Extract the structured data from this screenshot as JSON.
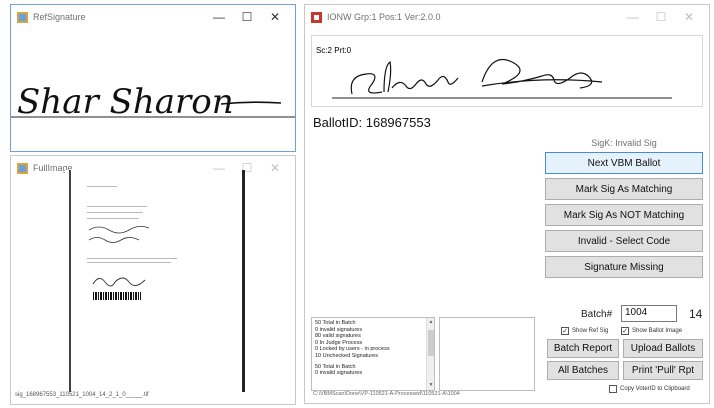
{
  "ref_window": {
    "title": "RefSignature",
    "signature_text": "Shar Sharon",
    "controls": [
      "—",
      "☐",
      "✕"
    ]
  },
  "full_window": {
    "title": "FullImage",
    "caption": "sig_168967553_110521_1004_14_2_1_0_____.tif",
    "controls": [
      "—",
      "☐",
      "✕"
    ]
  },
  "main_window": {
    "title": "IONW Grp:1 Pos:1 Ver:2.0.0",
    "controls": [
      "—",
      "☐",
      "✕"
    ],
    "sc_prt": "Sc:2 Prt:0",
    "ballot_id": "BallotID: 168967553",
    "sigk_status": "SigK: Invalid Sig",
    "buttons": {
      "next": "Next VBM Ballot",
      "match": "Mark Sig As Matching",
      "not_match": "Mark Sig As NOT Matching",
      "invalid": "Invalid - Select Code",
      "missing": "Signature Missing",
      "batch_report": "Batch Report",
      "upload": "Upload Ballots",
      "all_batches": "All Batches",
      "print_pull": "Print 'Pull' Rpt"
    },
    "stats": [
      "50 Total in Batch",
      "0 invalid signatures",
      "80 valid signatures",
      "0 In Judge Process",
      "0 Locked by users - in process",
      "10 Unchecked Signatures",
      "",
      "50 Total in Batch",
      "0 invalid signatures"
    ],
    "batch_label": "Batch#",
    "batch_value": "1004",
    "batch_count": "14",
    "show_ref_sig": "Show Ref Sig",
    "show_ballot_image": "Show Ballot Image",
    "copy_voterid": "Copy VoterID to Clipboard",
    "path": "C:\\VBMScan\\Done\\VP-110521-A-Processed\\110521-A\\1004"
  }
}
